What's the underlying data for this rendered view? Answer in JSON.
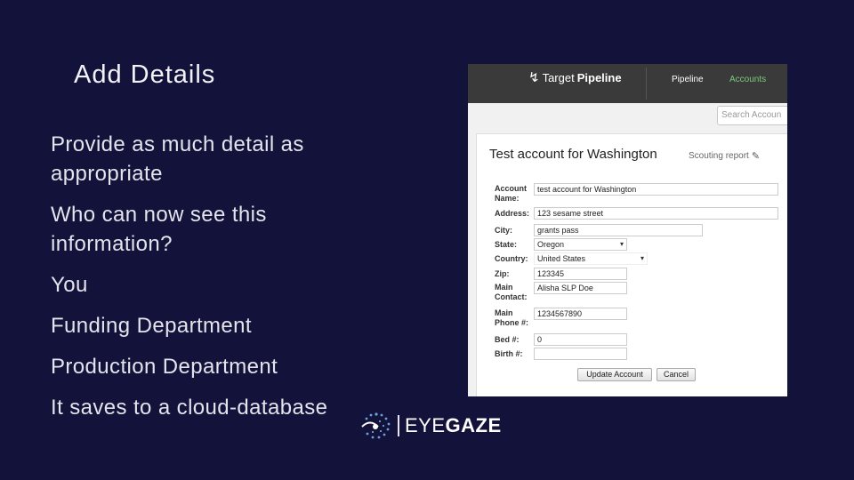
{
  "slide": {
    "title": "Add Details",
    "bullets": [
      "Provide as much detail as appropriate",
      "Who can now see this information?",
      "You",
      "Funding Department",
      "Production Department",
      "It saves to a cloud-database"
    ]
  },
  "screenshot": {
    "logo": {
      "prefix": "Target",
      "bold": "Pipeline",
      "icon": "target-pipeline-logo-icon"
    },
    "nav": {
      "pipeline": "Pipeline",
      "accounts": "Accounts",
      "accounts_color": "#7ec77e"
    },
    "search_placeholder": "Search Accoun",
    "card": {
      "title": "Test account for Washington",
      "subtitle": "Scouting report"
    },
    "fields": {
      "account_name": {
        "label1": "Account",
        "label2": "Name:",
        "value": "test account for Washington"
      },
      "address": {
        "label": "Address:",
        "value": "123 sesame street"
      },
      "city": {
        "label": "City:",
        "value": "grants pass"
      },
      "state": {
        "label": "State:",
        "value": "Oregon"
      },
      "country": {
        "label": "Country:",
        "value": "United States"
      },
      "zip": {
        "label": "Zip:",
        "value": "123345"
      },
      "main_contact": {
        "label1": "Main",
        "label2": "Contact:",
        "value": "Alisha SLP Doe"
      },
      "main_phone": {
        "label1": "Main",
        "label2": "Phone #:",
        "value": "1234567890"
      },
      "bed": {
        "label": "Bed #:",
        "value": "0"
      },
      "birth": {
        "label": "Birth #:",
        "value": ""
      }
    },
    "buttons": {
      "update": "Update Account",
      "cancel": "Cancel"
    }
  },
  "brand": {
    "prefix": "EYE",
    "bold": "GAZE",
    "icon": "eyegaze-logo-icon"
  },
  "colors": {
    "background": "#12123a",
    "topbar": "#3a3a3a"
  }
}
